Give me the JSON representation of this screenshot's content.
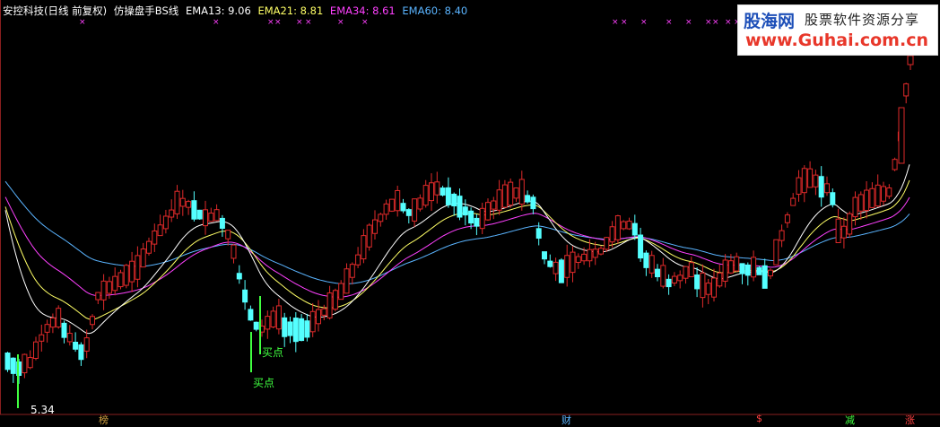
{
  "header": {
    "stock": "安控科技(日线 前复权)",
    "indicator": "仿操盘手BS线",
    "ema": [
      {
        "label": "EMA13: 9.06",
        "color": "#ffffff"
      },
      {
        "label": "EMA21: 8.81",
        "color": "#ffff66"
      },
      {
        "label": "EMA34: 8.61",
        "color": "#ff40ff"
      },
      {
        "label": "EMA60: 8.40",
        "color": "#5ab4ff"
      }
    ]
  },
  "watermark": {
    "logo": "股海网",
    "slogan": "股票软件资源分享",
    "url": "www.Guhai.com.cn"
  },
  "annotations": {
    "min_price": "5.34",
    "buy_point_1": "买点",
    "buy_point_2": "买点"
  },
  "bottom_markers": [
    {
      "text": "榜",
      "color": "#d0a040"
    },
    {
      "text": "财",
      "color": "#5ab4ff"
    },
    {
      "text": "$",
      "color": "#ff4040"
    },
    {
      "text": "减",
      "color": "#40ff40"
    },
    {
      "text": "涨",
      "color": "#ff4040"
    }
  ],
  "colors": {
    "up": "#e02a2a",
    "down": "#54ffff",
    "signal_green": "#40ff40",
    "signal_magenta": "#ff40ff"
  }
}
